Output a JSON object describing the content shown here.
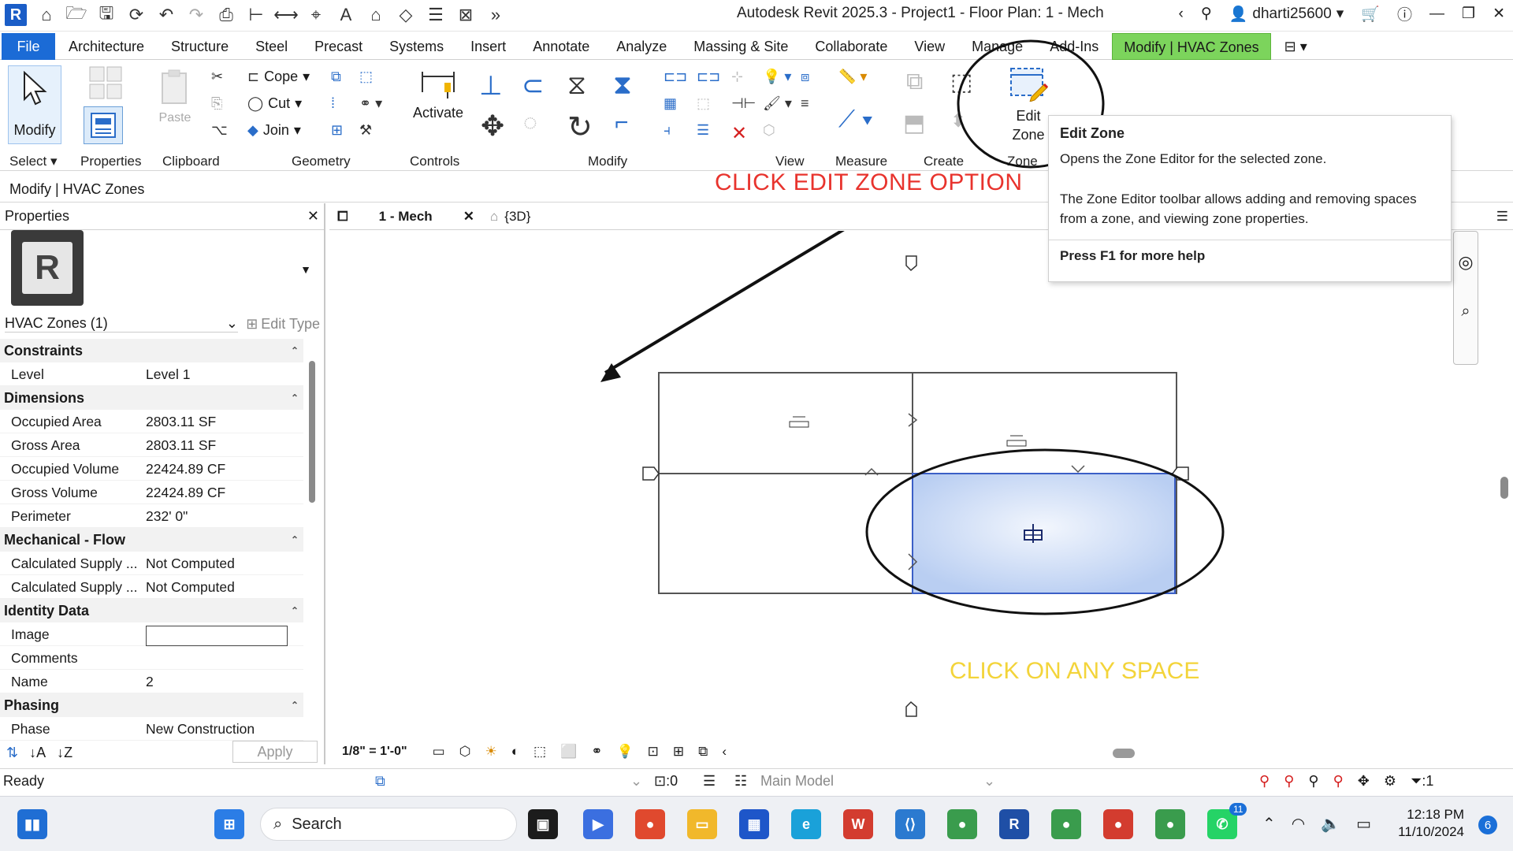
{
  "window": {
    "title": "Autodesk Revit 2025.3 - Project1 - Floor Plan: 1 - Mech",
    "username": "dharti25600"
  },
  "ribbon_tabs": [
    "File",
    "Architecture",
    "Structure",
    "Steel",
    "Precast",
    "Systems",
    "Insert",
    "Annotate",
    "Analyze",
    "Massing & Site",
    "Collaborate",
    "View",
    "Manage",
    "Add-Ins",
    "Modify | HVAC Zones"
  ],
  "ribbon": {
    "modify_label": "Modify",
    "paste_label": "Paste",
    "cope_label": "Cope",
    "cut_label": "Cut",
    "join_label": "Join",
    "activate_label": "Activate",
    "edit_zone_line1": "Edit",
    "edit_zone_line2": "Zone",
    "panels": {
      "select": "Select",
      "properties": "Properties",
      "clipboard": "Clipboard",
      "geometry": "Geometry",
      "controls": "Controls",
      "modify": "Modify",
      "view": "View",
      "measure": "Measure",
      "create": "Create",
      "zone": "Zone"
    }
  },
  "options_bar": {
    "context": "Modify | HVAC Zones"
  },
  "instructions": {
    "red": "CLICK  EDIT ZONE OPTION",
    "yellow": "CLICK ON ANY SPACE"
  },
  "tooltip": {
    "title": "Edit Zone",
    "description": "Opens the Zone Editor for the selected zone.",
    "details": "The Zone Editor toolbar allows adding and removing spaces from a zone, and viewing zone properties.",
    "help": "Press F1 for more help"
  },
  "properties": {
    "title": "Properties",
    "type_selector": "HVAC Zones (1)",
    "edit_type": "Edit Type",
    "groups": [
      {
        "name": "Constraints",
        "rows": [
          {
            "name": "Level",
            "value": "Level 1"
          }
        ]
      },
      {
        "name": "Dimensions",
        "rows": [
          {
            "name": "Occupied Area",
            "value": "2803.11 SF"
          },
          {
            "name": "Gross Area",
            "value": "2803.11 SF"
          },
          {
            "name": "Occupied Volume",
            "value": "22424.89 CF"
          },
          {
            "name": "Gross Volume",
            "value": "22424.89 CF"
          },
          {
            "name": "Perimeter",
            "value": "232'  0\""
          }
        ]
      },
      {
        "name": "Mechanical - Flow",
        "rows": [
          {
            "name": "Calculated Supply ...",
            "value": "Not Computed"
          },
          {
            "name": "Calculated Supply ...",
            "value": "Not Computed"
          }
        ]
      },
      {
        "name": "Identity Data",
        "rows": [
          {
            "name": "Image",
            "value": ""
          },
          {
            "name": "Comments",
            "value": ""
          },
          {
            "name": "Name",
            "value": "2"
          }
        ]
      },
      {
        "name": "Phasing",
        "rows": [
          {
            "name": "Phase",
            "value": "New Construction"
          }
        ]
      }
    ],
    "apply_label": "Apply"
  },
  "view_tabs": [
    {
      "label": "1 - Mech"
    },
    {
      "label": "{3D}"
    }
  ],
  "view_control": {
    "scale": "1/8\" = 1'-0\""
  },
  "status_bar": {
    "ready": "Ready",
    "workset_count": ":0",
    "model": "Main Model",
    "filter_count": ":1"
  },
  "taskbar": {
    "search_label": "Search",
    "time": "12:18 PM",
    "date": "11/10/2024",
    "notification_count": "6",
    "whatsapp_badge": "11"
  },
  "colors": {
    "file_tab": "#1b6bd6",
    "context_tab": "#7cd45c",
    "zone_fill": "#c7d8f5",
    "instruction_red": "#e8332d",
    "instruction_yellow": "#f3d43a"
  }
}
